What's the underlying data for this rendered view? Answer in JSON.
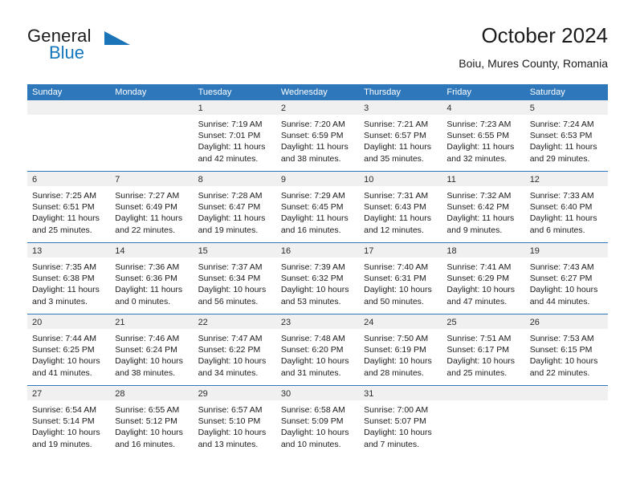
{
  "brand": {
    "word_one": "General",
    "word_two": "Blue",
    "triangle_color": "#1b74b8",
    "blue_text_color": "#1476bd"
  },
  "header": {
    "title": "October 2024",
    "location": "Boiu, Mures County, Romania"
  },
  "calendar": {
    "accent_color": "#2e77bb",
    "day_band_color": "#f0f0f0",
    "weekdays": [
      "Sunday",
      "Monday",
      "Tuesday",
      "Wednesday",
      "Thursday",
      "Friday",
      "Saturday"
    ],
    "weeks": [
      [
        {
          "day": "",
          "empty": true,
          "sunrise": "",
          "sunset": "",
          "daylight_line1": "",
          "daylight_line2": ""
        },
        {
          "day": "",
          "empty": true,
          "sunrise": "",
          "sunset": "",
          "daylight_line1": "",
          "daylight_line2": ""
        },
        {
          "day": "1",
          "sunrise": "Sunrise: 7:19 AM",
          "sunset": "Sunset: 7:01 PM",
          "daylight_line1": "Daylight: 11 hours",
          "daylight_line2": "and 42 minutes."
        },
        {
          "day": "2",
          "sunrise": "Sunrise: 7:20 AM",
          "sunset": "Sunset: 6:59 PM",
          "daylight_line1": "Daylight: 11 hours",
          "daylight_line2": "and 38 minutes."
        },
        {
          "day": "3",
          "sunrise": "Sunrise: 7:21 AM",
          "sunset": "Sunset: 6:57 PM",
          "daylight_line1": "Daylight: 11 hours",
          "daylight_line2": "and 35 minutes."
        },
        {
          "day": "4",
          "sunrise": "Sunrise: 7:23 AM",
          "sunset": "Sunset: 6:55 PM",
          "daylight_line1": "Daylight: 11 hours",
          "daylight_line2": "and 32 minutes."
        },
        {
          "day": "5",
          "sunrise": "Sunrise: 7:24 AM",
          "sunset": "Sunset: 6:53 PM",
          "daylight_line1": "Daylight: 11 hours",
          "daylight_line2": "and 29 minutes."
        }
      ],
      [
        {
          "day": "6",
          "sunrise": "Sunrise: 7:25 AM",
          "sunset": "Sunset: 6:51 PM",
          "daylight_line1": "Daylight: 11 hours",
          "daylight_line2": "and 25 minutes."
        },
        {
          "day": "7",
          "sunrise": "Sunrise: 7:27 AM",
          "sunset": "Sunset: 6:49 PM",
          "daylight_line1": "Daylight: 11 hours",
          "daylight_line2": "and 22 minutes."
        },
        {
          "day": "8",
          "sunrise": "Sunrise: 7:28 AM",
          "sunset": "Sunset: 6:47 PM",
          "daylight_line1": "Daylight: 11 hours",
          "daylight_line2": "and 19 minutes."
        },
        {
          "day": "9",
          "sunrise": "Sunrise: 7:29 AM",
          "sunset": "Sunset: 6:45 PM",
          "daylight_line1": "Daylight: 11 hours",
          "daylight_line2": "and 16 minutes."
        },
        {
          "day": "10",
          "sunrise": "Sunrise: 7:31 AM",
          "sunset": "Sunset: 6:43 PM",
          "daylight_line1": "Daylight: 11 hours",
          "daylight_line2": "and 12 minutes."
        },
        {
          "day": "11",
          "sunrise": "Sunrise: 7:32 AM",
          "sunset": "Sunset: 6:42 PM",
          "daylight_line1": "Daylight: 11 hours",
          "daylight_line2": "and 9 minutes."
        },
        {
          "day": "12",
          "sunrise": "Sunrise: 7:33 AM",
          "sunset": "Sunset: 6:40 PM",
          "daylight_line1": "Daylight: 11 hours",
          "daylight_line2": "and 6 minutes."
        }
      ],
      [
        {
          "day": "13",
          "sunrise": "Sunrise: 7:35 AM",
          "sunset": "Sunset: 6:38 PM",
          "daylight_line1": "Daylight: 11 hours",
          "daylight_line2": "and 3 minutes."
        },
        {
          "day": "14",
          "sunrise": "Sunrise: 7:36 AM",
          "sunset": "Sunset: 6:36 PM",
          "daylight_line1": "Daylight: 11 hours",
          "daylight_line2": "and 0 minutes."
        },
        {
          "day": "15",
          "sunrise": "Sunrise: 7:37 AM",
          "sunset": "Sunset: 6:34 PM",
          "daylight_line1": "Daylight: 10 hours",
          "daylight_line2": "and 56 minutes."
        },
        {
          "day": "16",
          "sunrise": "Sunrise: 7:39 AM",
          "sunset": "Sunset: 6:32 PM",
          "daylight_line1": "Daylight: 10 hours",
          "daylight_line2": "and 53 minutes."
        },
        {
          "day": "17",
          "sunrise": "Sunrise: 7:40 AM",
          "sunset": "Sunset: 6:31 PM",
          "daylight_line1": "Daylight: 10 hours",
          "daylight_line2": "and 50 minutes."
        },
        {
          "day": "18",
          "sunrise": "Sunrise: 7:41 AM",
          "sunset": "Sunset: 6:29 PM",
          "daylight_line1": "Daylight: 10 hours",
          "daylight_line2": "and 47 minutes."
        },
        {
          "day": "19",
          "sunrise": "Sunrise: 7:43 AM",
          "sunset": "Sunset: 6:27 PM",
          "daylight_line1": "Daylight: 10 hours",
          "daylight_line2": "and 44 minutes."
        }
      ],
      [
        {
          "day": "20",
          "sunrise": "Sunrise: 7:44 AM",
          "sunset": "Sunset: 6:25 PM",
          "daylight_line1": "Daylight: 10 hours",
          "daylight_line2": "and 41 minutes."
        },
        {
          "day": "21",
          "sunrise": "Sunrise: 7:46 AM",
          "sunset": "Sunset: 6:24 PM",
          "daylight_line1": "Daylight: 10 hours",
          "daylight_line2": "and 38 minutes."
        },
        {
          "day": "22",
          "sunrise": "Sunrise: 7:47 AM",
          "sunset": "Sunset: 6:22 PM",
          "daylight_line1": "Daylight: 10 hours",
          "daylight_line2": "and 34 minutes."
        },
        {
          "day": "23",
          "sunrise": "Sunrise: 7:48 AM",
          "sunset": "Sunset: 6:20 PM",
          "daylight_line1": "Daylight: 10 hours",
          "daylight_line2": "and 31 minutes."
        },
        {
          "day": "24",
          "sunrise": "Sunrise: 7:50 AM",
          "sunset": "Sunset: 6:19 PM",
          "daylight_line1": "Daylight: 10 hours",
          "daylight_line2": "and 28 minutes."
        },
        {
          "day": "25",
          "sunrise": "Sunrise: 7:51 AM",
          "sunset": "Sunset: 6:17 PM",
          "daylight_line1": "Daylight: 10 hours",
          "daylight_line2": "and 25 minutes."
        },
        {
          "day": "26",
          "sunrise": "Sunrise: 7:53 AM",
          "sunset": "Sunset: 6:15 PM",
          "daylight_line1": "Daylight: 10 hours",
          "daylight_line2": "and 22 minutes."
        }
      ],
      [
        {
          "day": "27",
          "sunrise": "Sunrise: 6:54 AM",
          "sunset": "Sunset: 5:14 PM",
          "daylight_line1": "Daylight: 10 hours",
          "daylight_line2": "and 19 minutes."
        },
        {
          "day": "28",
          "sunrise": "Sunrise: 6:55 AM",
          "sunset": "Sunset: 5:12 PM",
          "daylight_line1": "Daylight: 10 hours",
          "daylight_line2": "and 16 minutes."
        },
        {
          "day": "29",
          "sunrise": "Sunrise: 6:57 AM",
          "sunset": "Sunset: 5:10 PM",
          "daylight_line1": "Daylight: 10 hours",
          "daylight_line2": "and 13 minutes."
        },
        {
          "day": "30",
          "sunrise": "Sunrise: 6:58 AM",
          "sunset": "Sunset: 5:09 PM",
          "daylight_line1": "Daylight: 10 hours",
          "daylight_line2": "and 10 minutes."
        },
        {
          "day": "31",
          "sunrise": "Sunrise: 7:00 AM",
          "sunset": "Sunset: 5:07 PM",
          "daylight_line1": "Daylight: 10 hours",
          "daylight_line2": "and 7 minutes."
        },
        {
          "day": "",
          "empty": true,
          "sunrise": "",
          "sunset": "",
          "daylight_line1": "",
          "daylight_line2": ""
        },
        {
          "day": "",
          "empty": true,
          "sunrise": "",
          "sunset": "",
          "daylight_line1": "",
          "daylight_line2": ""
        }
      ]
    ]
  }
}
